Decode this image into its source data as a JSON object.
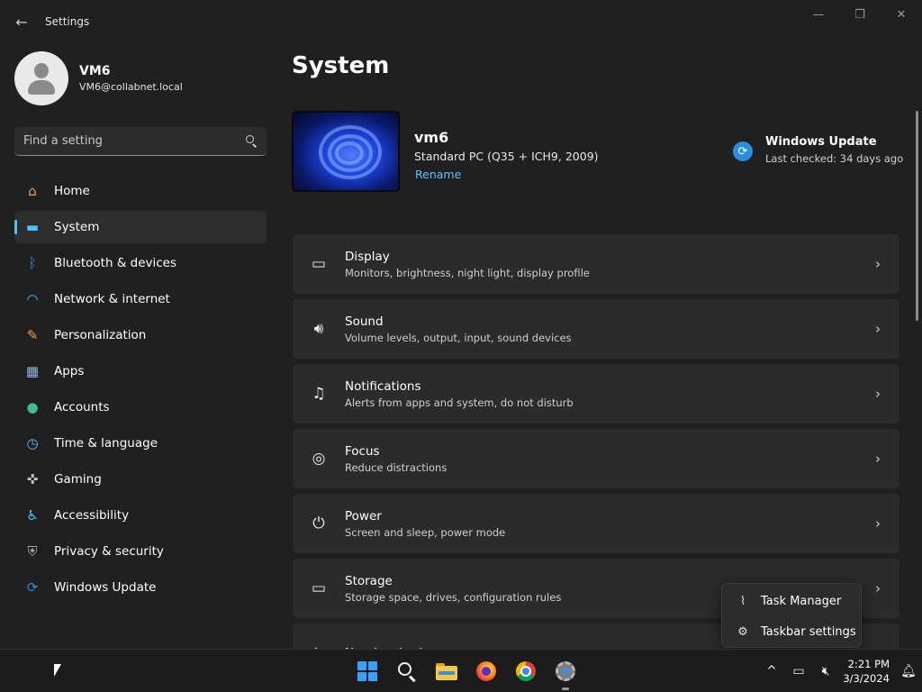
{
  "window": {
    "title": "Settings",
    "back_glyph": "←",
    "minimize_glyph": "—",
    "restore_glyph": "❐",
    "close_glyph": "✕"
  },
  "profile": {
    "name": "VM6",
    "email": "VM6@collabnet.local"
  },
  "search": {
    "placeholder": "Find a setting",
    "value": ""
  },
  "sidebar": {
    "items": [
      {
        "label": "Home",
        "icon": "home-icon",
        "glyph": "⌂",
        "color": "#f0a35e"
      },
      {
        "label": "System",
        "icon": "system-icon",
        "glyph": "▬",
        "color": "#4cc2ff",
        "active": true
      },
      {
        "label": "Bluetooth & devices",
        "icon": "bluetooth-icon",
        "glyph": "ᛒ",
        "color": "#2a8de0"
      },
      {
        "label": "Network & internet",
        "icon": "wifi-icon",
        "glyph": "◠",
        "color": "#4cc2ff"
      },
      {
        "label": "Personalization",
        "icon": "brush-icon",
        "glyph": "✎",
        "color": "#f0a35e"
      },
      {
        "label": "Apps",
        "icon": "apps-icon",
        "glyph": "▦",
        "color": "#8fb4e3"
      },
      {
        "label": "Accounts",
        "icon": "accounts-icon",
        "glyph": "●",
        "color": "#3fc08a"
      },
      {
        "label": "Time & language",
        "icon": "clock-globe-icon",
        "glyph": "◷",
        "color": "#4cc2ff"
      },
      {
        "label": "Gaming",
        "icon": "gamepad-icon",
        "glyph": "✜",
        "color": "#bdbdbd"
      },
      {
        "label": "Accessibility",
        "icon": "accessibility-icon",
        "glyph": "♿",
        "color": "#4cc2ff"
      },
      {
        "label": "Privacy & security",
        "icon": "shield-icon",
        "glyph": "⛨",
        "color": "#a8a8a8"
      },
      {
        "label": "Windows Update",
        "icon": "windows-update-icon",
        "glyph": "⟳",
        "color": "#2a8de0"
      }
    ]
  },
  "main": {
    "title": "System",
    "device": {
      "name": "vm6",
      "model": "Standard PC (Q35 + ICH9, 2009)",
      "rename_label": "Rename"
    },
    "windows_update": {
      "title": "Windows Update",
      "status": "Last checked: 34 days ago",
      "glyph": "⟳"
    },
    "cards": [
      {
        "title": "Display",
        "subtitle": "Monitors, brightness, night light, display profile",
        "icon": "monitor-icon",
        "glyph": "▭"
      },
      {
        "title": "Sound",
        "subtitle": "Volume levels, output, input, sound devices",
        "icon": "speaker-icon",
        "glyph": "🔊︎"
      },
      {
        "title": "Notifications",
        "subtitle": "Alerts from apps and system, do not disturb",
        "icon": "bell-icon",
        "glyph": "♫"
      },
      {
        "title": "Focus",
        "subtitle": "Reduce distractions",
        "icon": "focus-icon",
        "glyph": "◎"
      },
      {
        "title": "Power",
        "subtitle": "Screen and sleep, power mode",
        "icon": "power-icon",
        "glyph": "⏻"
      },
      {
        "title": "Storage",
        "subtitle": "Storage space, drives, configuration rules",
        "icon": "storage-icon",
        "glyph": "▭"
      },
      {
        "title": "Nearby sharing",
        "subtitle": "",
        "icon": "share-icon",
        "glyph": "⇆"
      }
    ],
    "chevron_glyph": "›"
  },
  "context_menu": {
    "items": [
      {
        "label": "Task Manager",
        "icon": "task-manager-icon",
        "glyph": "⌇"
      },
      {
        "label": "Taskbar settings",
        "icon": "gear-icon",
        "glyph": "⚙"
      }
    ]
  },
  "taskbar": {
    "tray": {
      "overflow_glyph": "^",
      "network_glyph": "▭",
      "volume_glyph": "🔇︎",
      "notification_glyph": "🔔︎",
      "time": "2:21 PM",
      "date": "3/3/2024"
    }
  }
}
